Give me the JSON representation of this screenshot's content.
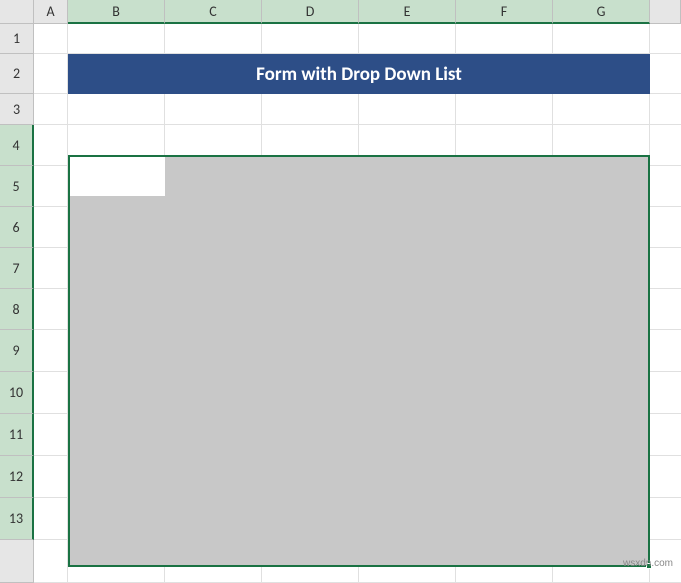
{
  "columns": [
    "A",
    "B",
    "C",
    "D",
    "E",
    "F",
    "G"
  ],
  "rows": [
    "1",
    "2",
    "3",
    "4",
    "5",
    "6",
    "7",
    "8",
    "9",
    "10",
    "11",
    "12",
    "13"
  ],
  "title_cell": {
    "text": "Form with Drop Down List",
    "range": "B2:G2"
  },
  "selection": {
    "range": "B4:G13",
    "active_cell": "B4"
  },
  "watermark": "wsxdn.com",
  "chart_data": null
}
